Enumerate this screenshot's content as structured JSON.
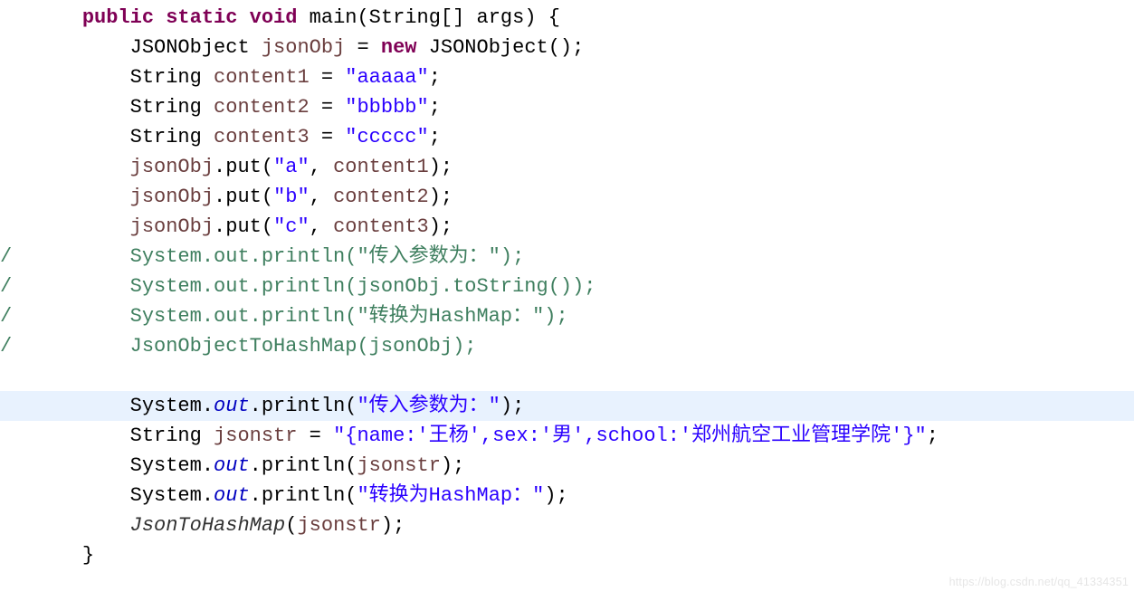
{
  "code": {
    "l01": {
      "kw1": "public",
      "kw2": "static",
      "kw3": "void",
      "name": "main",
      "args": "(String[] args) {"
    },
    "l02": {
      "typ": "JSONObject ",
      "var": "jsonObj",
      "eq": " = ",
      "kw": "new",
      "rest": " JSONObject();"
    },
    "l03": {
      "typ": "String ",
      "var": "content1",
      "eq": " = ",
      "str": "\"aaaaa\"",
      "semi": ";"
    },
    "l04": {
      "typ": "String ",
      "var": "content2",
      "eq": " = ",
      "str": "\"bbbbb\"",
      "semi": ";"
    },
    "l05": {
      "typ": "String ",
      "var": "content3",
      "eq": " = ",
      "str": "\"ccccc\"",
      "semi": ";"
    },
    "l06": {
      "var": "jsonObj",
      "mth": ".put(",
      "str": "\"a\"",
      "mid": ", ",
      "arg": "content1",
      "end": ");"
    },
    "l07": {
      "var": "jsonObj",
      "mth": ".put(",
      "str": "\"b\"",
      "mid": ", ",
      "arg": "content2",
      "end": ");"
    },
    "l08": {
      "var": "jsonObj",
      "mth": ".put(",
      "str": "\"c\"",
      "mid": ", ",
      "arg": "content3",
      "end": ");"
    },
    "l09": {
      "slash": "/",
      "txt": "System.out.println(\"传入参数为：\");"
    },
    "l10": {
      "slash": "/",
      "txt": "System.out.println(jsonObj.toString());"
    },
    "l11": {
      "slash": "/",
      "txt": "System.out.println(\"转换为HashMap：\");"
    },
    "l12": {
      "slash": "/",
      "txt": "JsonObjectToHashMap(jsonObj);"
    },
    "l14": {
      "sys": "System.",
      "out": "out",
      "p1": ".println(",
      "str": "\"传入参数为：\"",
      "p2": ");"
    },
    "l15": {
      "typ": "String ",
      "var": "jsonstr",
      "eq": " = ",
      "str": "\"{name:'王杨',sex:'男',school:'郑州航空工业管理学院'}\"",
      "semi": ";"
    },
    "l16": {
      "sys": "System.",
      "out": "out",
      "p1": ".println(",
      "arg": "jsonstr",
      "p2": ");"
    },
    "l17": {
      "sys": "System.",
      "out": "out",
      "p1": ".println(",
      "str": "\"转换为HashMap：\"",
      "p2": ");"
    },
    "l18": {
      "call": "JsonToHashMap",
      "p1": "(",
      "arg": "jsonstr",
      "p2": ");"
    },
    "l19": {
      "brace": "}"
    }
  },
  "watermark": "https://blog.csdn.net/qq_41334351"
}
